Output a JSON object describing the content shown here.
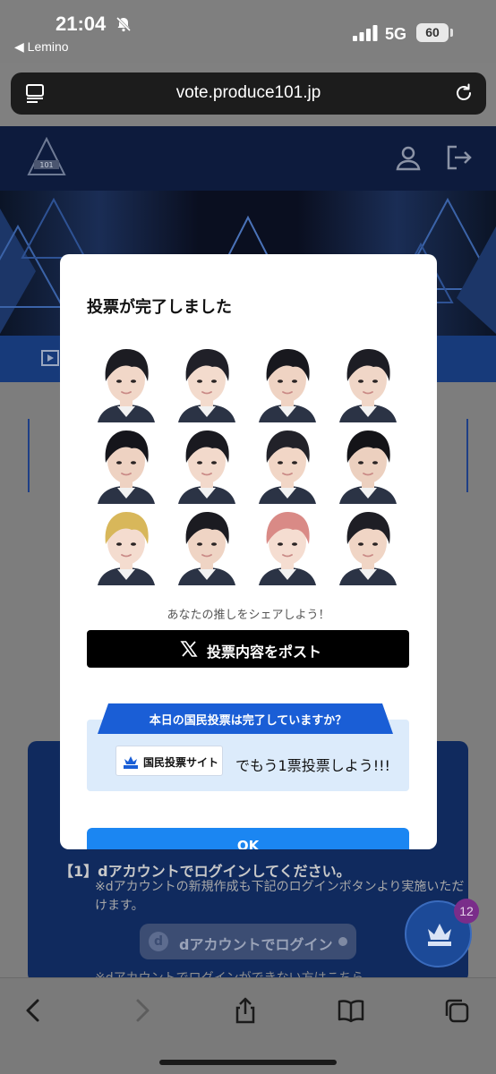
{
  "status_bar": {
    "time": "21:04",
    "back_app": "◀ Lemino",
    "network": "5G",
    "battery": "60"
  },
  "url_bar": {
    "url": "vote.produce101.jp"
  },
  "modal": {
    "title": "投票が完了しました",
    "share_text": "あなたの推しをシェアしよう！",
    "post_button": "投票内容をポスト",
    "promo_banner": "本日の国民投票は完了していますか？",
    "site_chip": "国民投票サイト",
    "promo_cta": "でもう1票投票しよう!!!",
    "ok_button": "OK",
    "faces": [
      {
        "hair": "#1c1c22",
        "skin": "#f1d7c8"
      },
      {
        "hair": "#202028",
        "skin": "#f3dbcd"
      },
      {
        "hair": "#18181e",
        "skin": "#efd3c3"
      },
      {
        "hair": "#1d1d24",
        "skin": "#f0d6c7"
      },
      {
        "hair": "#15151b",
        "skin": "#eed2c2"
      },
      {
        "hair": "#1a1a20",
        "skin": "#f2d9cb"
      },
      {
        "hair": "#222229",
        "skin": "#f1d6c6"
      },
      {
        "hair": "#141418",
        "skin": "#ecd0bf"
      },
      {
        "hair": "#d8b75a",
        "skin": "#f4dccf"
      },
      {
        "hair": "#1b1b21",
        "skin": "#efd4c4"
      },
      {
        "hair": "#d98a86",
        "skin": "#f5ddd1"
      },
      {
        "hair": "#1e1e25",
        "skin": "#f0d5c5"
      }
    ]
  },
  "background_page": {
    "login_step": "【1】dアカウントでログインしてください。",
    "login_note": "※dアカウントの新規作成も下記のログインボタンより実施いただけます。",
    "dlogin_button": "dアカウントでログイン",
    "login_help": "※dアカウントでログインができない方はこちら",
    "fab_badge": "12"
  },
  "colors": {
    "accent_blue": "#1b86f2",
    "header_navy": "#0d1b3d",
    "promo_banner_blue": "#1a5ed6",
    "promo_bg": "#dcebfb"
  }
}
